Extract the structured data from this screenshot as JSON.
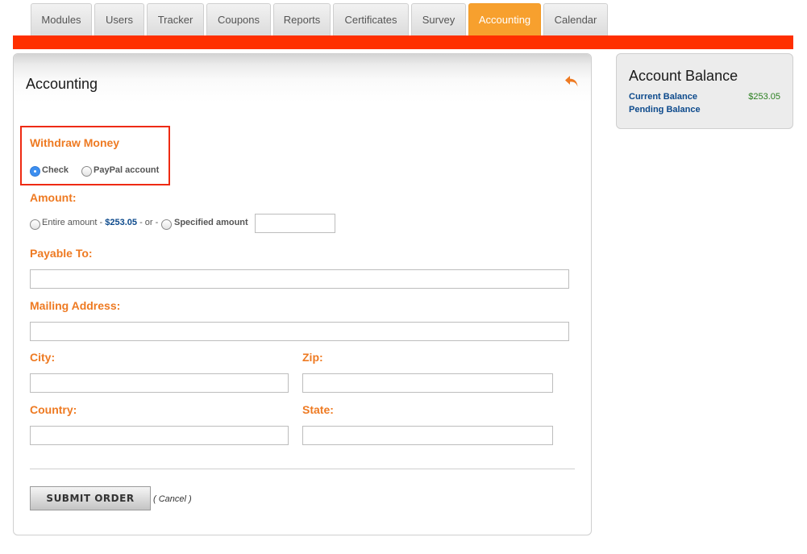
{
  "tabs": [
    {
      "label": "Modules",
      "active": false
    },
    {
      "label": "Users",
      "active": false
    },
    {
      "label": "Tracker",
      "active": false
    },
    {
      "label": "Coupons",
      "active": false
    },
    {
      "label": "Reports",
      "active": false
    },
    {
      "label": "Certificates",
      "active": false
    },
    {
      "label": "Survey",
      "active": false
    },
    {
      "label": "Accounting",
      "active": true
    },
    {
      "label": "Calendar",
      "active": false
    }
  ],
  "colors": {
    "accent_orange": "#f7a02e",
    "red_bar": "#ff2f00",
    "label_orange": "#ee7a22",
    "link_blue": "#0d4a8c",
    "money_green": "#2a7f1f",
    "highlight_red": "#ee2a12"
  },
  "panel": {
    "title": "Accounting",
    "back_icon": "undo-arrow-icon"
  },
  "withdraw": {
    "heading": "Withdraw Money",
    "options": [
      {
        "label": "Check",
        "selected": true
      },
      {
        "label": "PayPal account",
        "selected": false
      }
    ]
  },
  "amount": {
    "heading": "Amount:",
    "entire_label": "Entire amount - ",
    "entire_value": "$253.05",
    "or_text": " - or -",
    "specified_label": "Specified amount",
    "specified_value": ""
  },
  "fields": {
    "payable_to": {
      "label": "Payable To:",
      "value": ""
    },
    "mailing_address": {
      "label": "Mailing Address:",
      "value": ""
    },
    "city": {
      "label": "City:",
      "value": ""
    },
    "zip": {
      "label": "Zip:",
      "value": ""
    },
    "country": {
      "label": "Country:",
      "value": ""
    },
    "state": {
      "label": "State:",
      "value": ""
    }
  },
  "actions": {
    "submit_label": "SUBMIT ORDER",
    "cancel_prefix": "( ",
    "cancel_label": "Cancel",
    "cancel_suffix": " )"
  },
  "balance": {
    "title": "Account Balance",
    "current_label": "Current Balance",
    "current_value": "$253.05",
    "pending_label": "Pending Balance",
    "pending_value": ""
  }
}
